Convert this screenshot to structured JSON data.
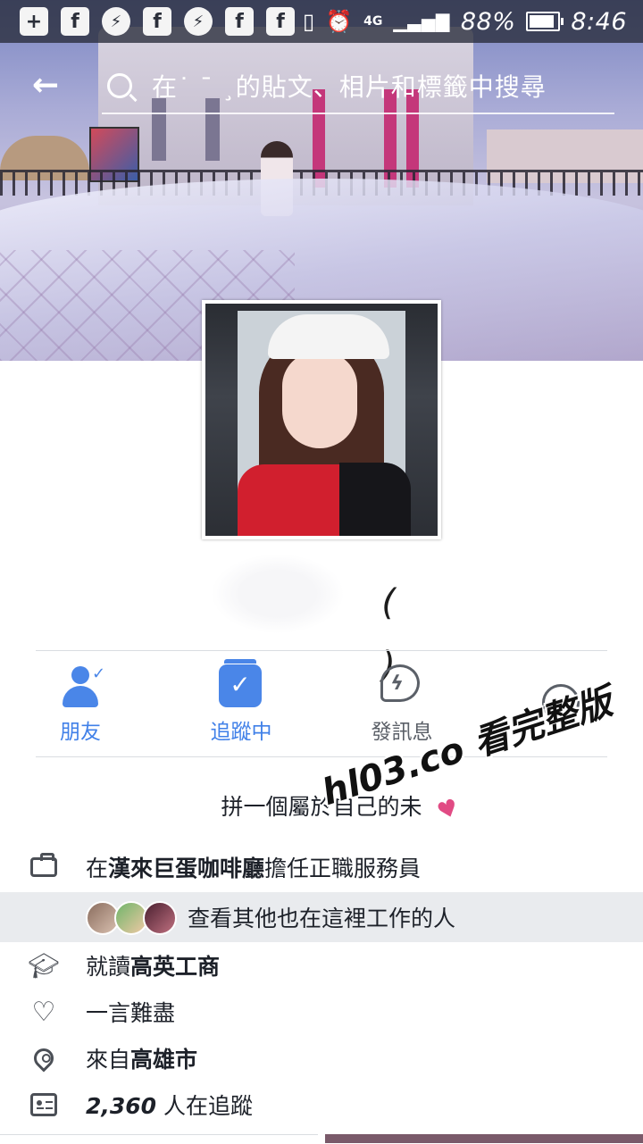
{
  "status_bar": {
    "battery_text": "88%",
    "battery_level": 0.88,
    "time": "8:46",
    "network": "4G",
    "notification_icons": [
      "plus-icon",
      "facebook-icon",
      "messenger-icon",
      "facebook-icon",
      "messenger-icon",
      "facebook-icon",
      "facebook-icon"
    ]
  },
  "header": {
    "search_placeholder": "在˙ ¯ ¸的貼文、相片和標籤中搜尋"
  },
  "profile": {
    "name_visible": "( )"
  },
  "actions": {
    "friends_label": "朋友",
    "following_label": "追蹤中",
    "message_label": "發訊息",
    "more_label": "···"
  },
  "bio": {
    "text": "拼一個屬於自己的未"
  },
  "watermark": {
    "text": "hl03.co 看完整版"
  },
  "info": {
    "work_prefix": "在",
    "work_place": "漢來巨蛋咖啡廳",
    "work_suffix": "擔任正職服務員",
    "coworkers_text": "查看其他也在這裡工作的人",
    "school_prefix": "就讀",
    "school_name": "高英工商",
    "relationship": "一言難盡",
    "hometown_prefix": "來自",
    "hometown": "高雄市",
    "followers_count": "2,360",
    "followers_suffix": " 人在追蹤"
  },
  "colors": {
    "accent": "#4080e8",
    "icon_grey": "#5b6068",
    "row_highlight": "#e9ebee"
  }
}
